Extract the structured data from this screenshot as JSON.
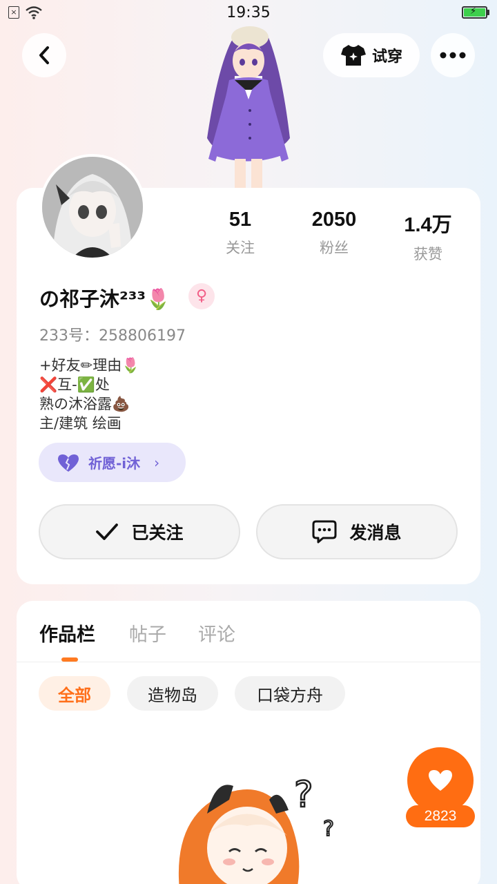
{
  "status_bar": {
    "time": "19:35"
  },
  "top_bar": {
    "back_icon": "chevron-left-icon",
    "tryon_icon": "shirt-icon",
    "tryon_label": "试穿",
    "more_icon": "more-dots-icon"
  },
  "profile": {
    "stats": [
      {
        "value": "51",
        "label": "关注"
      },
      {
        "value": "2050",
        "label": "粉丝"
      },
      {
        "value": "1.4万",
        "label": "获赞"
      }
    ],
    "username": "の祁子沐²³³🌷",
    "gender_symbol": "♀",
    "user_id": "233号：258806197",
    "bio": [
      "+好友✏理由🌷",
      "❌互-✅处",
      "熟の沐浴露💩",
      "主/建筑 绘画"
    ],
    "wish_chip": {
      "icon": "heart-icon",
      "label": "祈愿-i沐",
      "chevron": "›"
    },
    "follow_button": {
      "icon": "check-icon",
      "label": "已关注"
    },
    "message_button": {
      "icon": "chat-bubble-icon",
      "label": "发消息"
    }
  },
  "works": {
    "tabs": [
      {
        "label": "作品栏",
        "active": true
      },
      {
        "label": "帖子",
        "active": false
      },
      {
        "label": "评论",
        "active": false
      }
    ],
    "filters": [
      {
        "label": "全部",
        "active": true
      },
      {
        "label": "造物岛",
        "active": false
      },
      {
        "label": "口袋方舟",
        "active": false
      }
    ]
  },
  "like_fab": {
    "icon": "heart-icon",
    "count": "2823"
  },
  "colors": {
    "accent": "#ff6d12",
    "wish_purple": "#7061d6",
    "female_pink": "#f25d86"
  }
}
